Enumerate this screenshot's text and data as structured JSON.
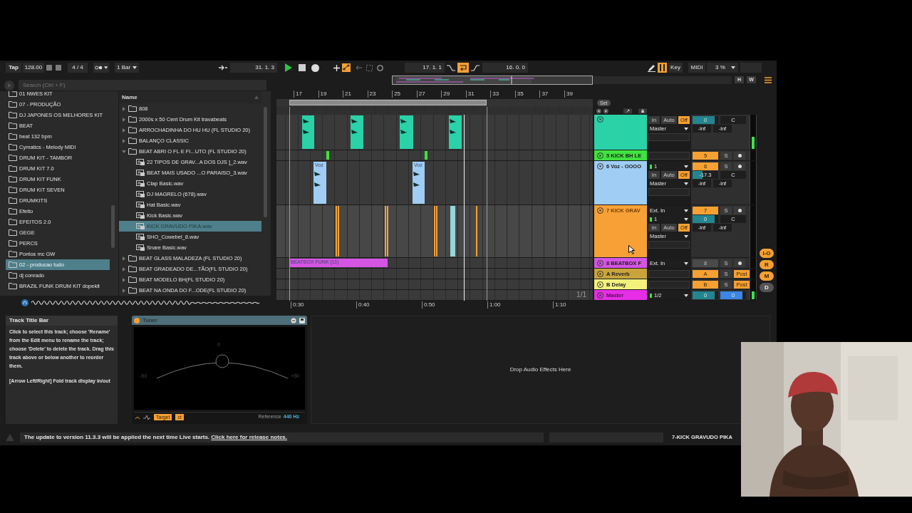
{
  "transport": {
    "tap": "Tap",
    "tempo": "128.00",
    "signature": "4 / 4",
    "quantization": "1 Bar",
    "position": "31. 1. 3",
    "playing": true,
    "recording": false,
    "automation_arm": true,
    "loop_start": "17. 1. 1",
    "loop_on": true,
    "loop_length": "16. 0. 0",
    "keyboard_on": true,
    "key": "Key",
    "midi": "MIDI",
    "cpu": "3 %"
  },
  "browser": {
    "search_placeholder": "Search (Ctrl + F)",
    "places": [
      {
        "label": "01 NWES KIT",
        "selected": false
      },
      {
        "label": "07 - PRODUÇÃO",
        "selected": false
      },
      {
        "label": "DJ JAPONES OS MELHORES KIT",
        "selected": false
      },
      {
        "label": "BEAT",
        "selected": false
      },
      {
        "label": "beat 132 bpm",
        "selected": false
      },
      {
        "label": "Cymatics - Melody MIDI",
        "selected": false
      },
      {
        "label": "DRUM KIT - TAMBOR",
        "selected": false
      },
      {
        "label": "DRUM KIT 7.0",
        "selected": false
      },
      {
        "label": "DRUM KIT FUNK",
        "selected": false
      },
      {
        "label": "DRUM KIT SEVEN",
        "selected": false
      },
      {
        "label": "DRUMKITS",
        "selected": false
      },
      {
        "label": "Efeito",
        "selected": false
      },
      {
        "label": "EFEITOS 2.0",
        "selected": false
      },
      {
        "label": "GEGE",
        "selected": false
      },
      {
        "label": "PERCS",
        "selected": false
      },
      {
        "label": "Pontos mc GW",
        "selected": false
      },
      {
        "label": "02 - producao tudo",
        "selected": true
      },
      {
        "label": "dj conrado",
        "selected": false
      },
      {
        "label": "BRAZIL FUNK DRUM KIT dopekit",
        "selected": false
      }
    ],
    "column_header": "Name",
    "files": [
      {
        "label": "808",
        "kind": "folder",
        "expanded": false,
        "selected": false
      },
      {
        "label": "2000s x 50 Cent Drum Kit travabeats",
        "kind": "folder",
        "expanded": false,
        "selected": false
      },
      {
        "label": "ARROCHADINHA DO HU HU (FL STUDIO 20)",
        "kind": "folder",
        "expanded": false,
        "selected": false
      },
      {
        "label": "BALANÇO CLASSIC",
        "kind": "folder",
        "expanded": false,
        "selected": false
      },
      {
        "label": "BEAT ABRI O FL E FI...UTO (FL STUDIO 20)",
        "kind": "folder",
        "expanded": true,
        "selected": false,
        "children": [
          {
            "label": "22 TIPOS DE GRAV...A DOS DJS ]_2.wav",
            "kind": "audio",
            "selected": false
          },
          {
            "label": "BEAT MAIS USADO ...O PARAISO_3.wav",
            "kind": "audio",
            "selected": false
          },
          {
            "label": "Clap Basic.wav",
            "kind": "audio",
            "selected": false
          },
          {
            "label": "DJ MAGRELO (678).wav",
            "kind": "audio",
            "selected": false
          },
          {
            "label": "Hat Basic.wav",
            "kind": "audio",
            "selected": false
          },
          {
            "label": "Kick Basic.wav",
            "kind": "audio",
            "selected": false
          },
          {
            "label": "KICK GRAVUDO PIKA.wav",
            "kind": "audio",
            "selected": true
          },
          {
            "label": "SHO_Cowebel_8.wav",
            "kind": "audio",
            "selected": false
          },
          {
            "label": "Snare Basic.wav",
            "kind": "audio",
            "selected": false
          }
        ]
      },
      {
        "label": "BEAT GLASS MALADEZA (FL STUDIO 20)",
        "kind": "folder",
        "expanded": false,
        "selected": false
      },
      {
        "label": "BEAT GRADEADO DE...TÃO(FL STUDIO 20)",
        "kind": "folder",
        "expanded": false,
        "selected": false
      },
      {
        "label": "BEAT MODELO BH(FL STUDIO 20)",
        "kind": "folder",
        "expanded": false,
        "selected": false
      },
      {
        "label": "BEAT NA ONDA DO F...ODE(FL STUDIO 20)",
        "kind": "folder",
        "expanded": false,
        "selected": false
      }
    ]
  },
  "arrangement": {
    "bar_ticks": [
      "17",
      "19",
      "21",
      "23",
      "25",
      "27",
      "29",
      "31",
      "33",
      "35",
      "37",
      "39"
    ],
    "time_ticks": [
      "0:30",
      "0:40",
      "0:50",
      "1:00",
      "1:10"
    ],
    "set": "Set",
    "page_indicator": "1/1",
    "overview_buttons": [
      "H",
      "W"
    ],
    "tracks": [
      {
        "color": "#2ad2a8",
        "expanded": true,
        "meter": {
          "level": 0.35
        },
        "io": [
          {
            "kind": "monitor",
            "options": [
              {
                "label": "In",
                "selected": false
              },
              {
                "label": "Auto",
                "selected": false
              },
              {
                "label": "Off",
                "selected": true
              }
            ]
          },
          {
            "kind": "dropdown",
            "value": "Master"
          },
          {
            "kind": "blank"
          }
        ],
        "mixer": [
          [
            {
              "kind": "volume",
              "label": "0",
              "level": 0.85
            },
            {
              "kind": "pan",
              "label": "C"
            }
          ],
          [
            {
              "kind": "readout",
              "label": "-inf"
            },
            {
              "kind": "readout",
              "label": "-inf"
            }
          ]
        ]
      },
      {
        "name": "5 KICK BH LE",
        "color": "#3fe23f",
        "expanded": false,
        "io": [
          {
            "kind": "blank"
          }
        ],
        "mixer": [
          [
            {
              "kind": "activator",
              "label": "5",
              "on": true
            },
            {
              "kind": "solo",
              "label": "S"
            },
            {
              "kind": "arm"
            }
          ]
        ]
      },
      {
        "name": "6 Voz - OOOO",
        "color": "#9fcdf3",
        "expanded": true,
        "clips": [
          {
            "label": "Voz"
          },
          {
            "label": "Voz"
          }
        ],
        "io": [
          {
            "kind": "dropdown",
            "value": "1",
            "signal": true
          },
          {
            "kind": "monitor",
            "options": [
              {
                "label": "In",
                "selected": false
              },
              {
                "label": "Auto",
                "selected": false
              },
              {
                "label": "Off",
                "selected": true
              }
            ]
          },
          {
            "kind": "dropdown",
            "value": "Master"
          },
          {
            "kind": "blank"
          }
        ],
        "mixer": [
          [
            {
              "kind": "activator",
              "label": "6",
              "on": true
            },
            {
              "kind": "solo",
              "label": "S"
            },
            {
              "kind": "arm"
            }
          ],
          [
            {
              "kind": "volume",
              "label": "-17.3",
              "level": 0.4
            },
            {
              "kind": "pan",
              "label": "C"
            }
          ],
          [
            {
              "kind": "readout",
              "label": "-inf"
            },
            {
              "kind": "readout",
              "label": "-inf"
            }
          ]
        ]
      },
      {
        "name": "7 KICK GRAV",
        "color": "#f7a036",
        "expanded": true,
        "io": [
          {
            "kind": "dropdown",
            "value": "Ext. In"
          },
          {
            "kind": "dropdown",
            "value": "1",
            "signal": true
          },
          {
            "kind": "monitor",
            "options": [
              {
                "label": "In",
                "selected": false
              },
              {
                "label": "Auto",
                "selected": false
              },
              {
                "label": "Off",
                "selected": true
              }
            ]
          },
          {
            "kind": "dropdown",
            "value": "Master"
          },
          {
            "kind": "blank"
          }
        ],
        "mixer": [
          [
            {
              "kind": "activator",
              "label": "7",
              "on": true
            },
            {
              "kind": "solo",
              "label": "S"
            },
            {
              "kind": "arm"
            }
          ],
          [
            {
              "kind": "volume",
              "label": "0",
              "level": 0.85
            },
            {
              "kind": "pan",
              "label": "C"
            }
          ],
          [
            {
              "kind": "readout",
              "label": "-inf"
            },
            {
              "kind": "readout",
              "label": "-inf"
            }
          ]
        ]
      },
      {
        "name": "8 BEATBOX F",
        "color": "#d455e3",
        "expanded": false,
        "clips": [
          {
            "label": "BEATBOX FUNK (11)"
          }
        ],
        "io": [
          {
            "kind": "dropdown",
            "value": "Ext. In"
          }
        ],
        "mixer": [
          [
            {
              "kind": "activator",
              "label": "8",
              "on": false
            },
            {
              "kind": "solo",
              "label": "S"
            },
            {
              "kind": "arm"
            }
          ]
        ]
      },
      {
        "name": "A Reverb",
        "color": "#c9a43c",
        "expanded": false,
        "io": [
          {
            "kind": "blank"
          }
        ],
        "mixer": [
          [
            {
              "kind": "activator",
              "label": "A",
              "on": true
            },
            {
              "kind": "solo",
              "label": "S"
            },
            {
              "kind": "post",
              "label": "Post"
            }
          ]
        ]
      },
      {
        "name": "B Delay",
        "color": "#f2f27c",
        "expanded": false,
        "io": [
          {
            "kind": "blank"
          }
        ],
        "mixer": [
          [
            {
              "kind": "activator",
              "label": "B",
              "on": true
            },
            {
              "kind": "solo",
              "label": "S"
            },
            {
              "kind": "post",
              "label": "Post"
            }
          ]
        ]
      },
      {
        "name": "Master",
        "color": "#e52ee6",
        "expanded": false,
        "meter": {
          "level": 0.8
        },
        "io": [
          {
            "kind": "dropdown",
            "value": "1/2",
            "signal": true
          }
        ],
        "mixer": [
          [
            {
              "kind": "volume",
              "label": "0",
              "level": 0.85
            },
            {
              "kind": "cue",
              "label": "0",
              "level": 0.85
            }
          ]
        ]
      }
    ]
  },
  "side_buttons": [
    {
      "label": "I-O",
      "on": true
    },
    {
      "label": "R",
      "on": true
    },
    {
      "label": "M",
      "on": true
    },
    {
      "label": "D",
      "on": false
    }
  ],
  "info": {
    "title": "Track Title Bar",
    "paragraphs": [
      "Click to select this track; choose 'Rename' from the Edit menu to rename the track; choose 'Delete' to delete the track. Drag this track above or below another to reorder them.",
      "[Arrow Left/Right] Fold track display in/out"
    ]
  },
  "device": {
    "title": "Tuner",
    "on": true,
    "center": "0",
    "min": "-50",
    "max": "+50",
    "buttons": [
      {
        "label": "Target",
        "selected": true
      },
      {
        "label": "ct",
        "selected": true
      }
    ],
    "reference_label": "Reference",
    "reference": "440 Hz"
  },
  "drop_hint": "Drop Audio Effects Here",
  "status": {
    "message": "The update to version 11.3.3 will be applied the next time Live starts.",
    "link": "Click here for release notes.",
    "selected_track": "7-KICK GRAVUDO PIKA"
  }
}
